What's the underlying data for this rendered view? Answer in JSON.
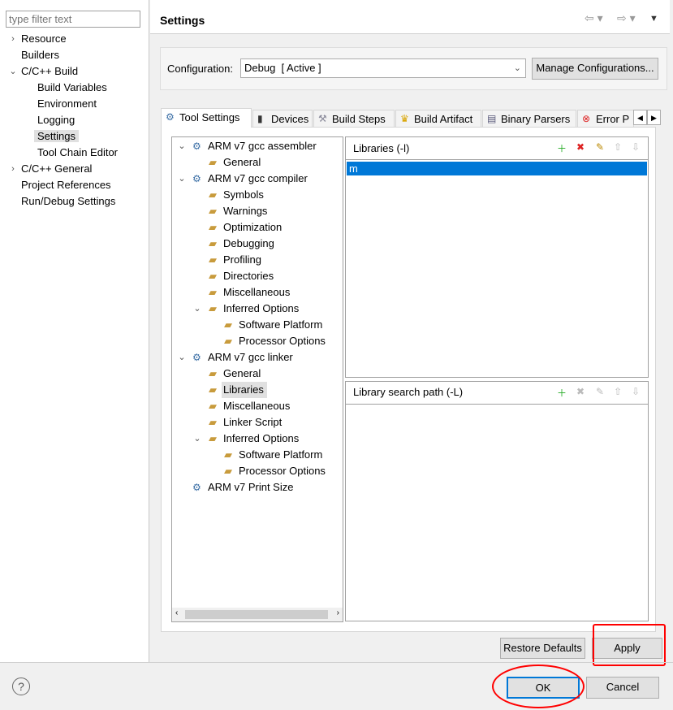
{
  "filter": {
    "placeholder": "type filter text"
  },
  "nav_tree": [
    {
      "label": "Resource",
      "level": 0,
      "chevron": "right"
    },
    {
      "label": "Builders",
      "level": 0
    },
    {
      "label": "C/C++ Build",
      "level": 0,
      "chevron": "down"
    },
    {
      "label": "Build Variables",
      "level": 1
    },
    {
      "label": "Environment",
      "level": 1
    },
    {
      "label": "Logging",
      "level": 1
    },
    {
      "label": "Settings",
      "level": 1,
      "selected": true
    },
    {
      "label": "Tool Chain Editor",
      "level": 1
    },
    {
      "label": "C/C++ General",
      "level": 0,
      "chevron": "right"
    },
    {
      "label": "Project References",
      "level": 0
    },
    {
      "label": "Run/Debug Settings",
      "level": 0
    }
  ],
  "header": {
    "title": "Settings"
  },
  "config": {
    "label": "Configuration:",
    "value": "Debug  [ Active ]",
    "manage": "Manage Configurations..."
  },
  "tabs": [
    {
      "label": "Tool Settings",
      "icon": "gear-icon",
      "active": true
    },
    {
      "label": "Devices",
      "icon": "chip-icon"
    },
    {
      "label": "Build Steps",
      "icon": "hammer-icon"
    },
    {
      "label": "Build Artifact",
      "icon": "trophy-icon"
    },
    {
      "label": "Binary Parsers",
      "icon": "binary-icon"
    },
    {
      "label": "Error P",
      "icon": "error-icon"
    }
  ],
  "tool_tree": [
    {
      "label": "ARM v7 gcc assembler",
      "level": 0,
      "chevron": "down",
      "icon": "tool"
    },
    {
      "label": "General",
      "level": 1,
      "icon": "folder"
    },
    {
      "label": "ARM v7 gcc compiler",
      "level": 0,
      "chevron": "down",
      "icon": "tool"
    },
    {
      "label": "Symbols",
      "level": 1,
      "icon": "folder"
    },
    {
      "label": "Warnings",
      "level": 1,
      "icon": "folder"
    },
    {
      "label": "Optimization",
      "level": 1,
      "icon": "folder"
    },
    {
      "label": "Debugging",
      "level": 1,
      "icon": "folder"
    },
    {
      "label": "Profiling",
      "level": 1,
      "icon": "folder"
    },
    {
      "label": "Directories",
      "level": 1,
      "icon": "folder"
    },
    {
      "label": "Miscellaneous",
      "level": 1,
      "icon": "folder"
    },
    {
      "label": "Inferred Options",
      "level": 1,
      "chevron": "down",
      "icon": "folder"
    },
    {
      "label": "Software Platform",
      "level": 2,
      "icon": "folder"
    },
    {
      "label": "Processor Options",
      "level": 2,
      "icon": "folder"
    },
    {
      "label": "ARM v7 gcc linker",
      "level": 0,
      "chevron": "down",
      "icon": "tool"
    },
    {
      "label": "General",
      "level": 1,
      "icon": "folder"
    },
    {
      "label": "Libraries",
      "level": 1,
      "icon": "folder",
      "selected": true
    },
    {
      "label": "Miscellaneous",
      "level": 1,
      "icon": "folder"
    },
    {
      "label": "Linker Script",
      "level": 1,
      "icon": "folder"
    },
    {
      "label": "Inferred Options",
      "level": 1,
      "chevron": "down",
      "icon": "folder"
    },
    {
      "label": "Software Platform",
      "level": 2,
      "icon": "folder"
    },
    {
      "label": "Processor Options",
      "level": 2,
      "icon": "folder"
    },
    {
      "label": "ARM v7 Print Size",
      "level": 0,
      "icon": "tool"
    }
  ],
  "libraries": {
    "title": "Libraries (-l)",
    "items": [
      "m"
    ]
  },
  "search_path": {
    "title": "Library search path (-L)",
    "items": []
  },
  "buttons": {
    "restore": "Restore Defaults",
    "apply": "Apply",
    "ok": "OK",
    "cancel": "Cancel"
  },
  "colors": {
    "selection": "#0078d7",
    "annotation": "#ff0000"
  }
}
